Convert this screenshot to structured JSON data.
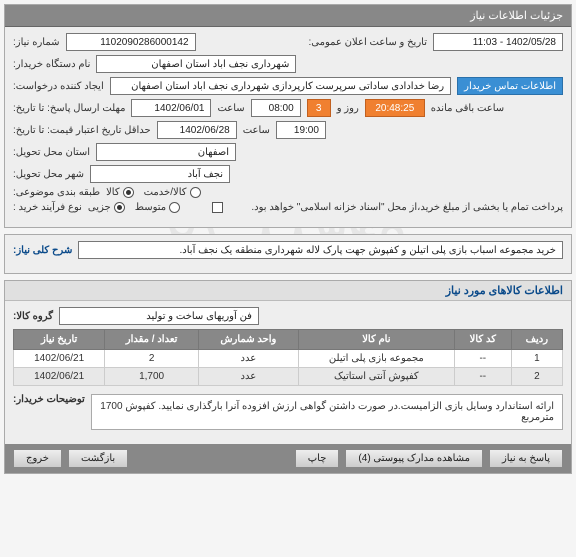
{
  "header": {
    "title": "جزئیات اطلاعات نیاز"
  },
  "info": {
    "reqNoLabel": "شماره نیاز:",
    "reqNo": "1102090286000142",
    "pubDateLabel": "تاریخ و ساعت اعلان عمومی:",
    "pubDate": "1402/05/28 - 11:03",
    "buyerLabel": "نام دستگاه خریدار:",
    "buyer": "شهرداری نجف اباد استان اصفهان",
    "creatorLabel": "ایجاد کننده درخواست:",
    "creatorValue": "رضا خدادادی ساداتی سرپرست  کارپردازی شهرداری نجف اباد استان اصفهان",
    "contactBtn": "اطلاعات تماس خریدار",
    "responseEndLabel": "مهلت ارسال پاسخ: تا تاریخ:",
    "responseEndDate": "1402/06/01",
    "hourLabel": "ساعت",
    "responseEndHour": "08:00",
    "daysSuffix": "روز و",
    "countdownDays": "3",
    "countdown": "20:48:25",
    "remainLabel": "ساعت باقی مانده",
    "priceValidLabel": "حداقل تاریخ اعتبار قیمت: تا تاریخ:",
    "priceValidDate": "1402/06/28",
    "priceValidHour": "19:00",
    "provinceLabel": "استان محل تحویل:",
    "province": "اصفهان",
    "cityLabel": "شهر محل تحویل:",
    "city": "نجف آباد",
    "classLabel": "طبقه بندی موضوعی:",
    "classKala": "کالا",
    "classKhedmat": "کالا/خدمت",
    "processLabel": "نوع فرآیند خرید :",
    "processJozi": "جزیی",
    "processMotavaset": "متوسط",
    "partialPayNote": "پرداخت تمام یا بخشی از مبلغ خرید،از محل \"اسناد خزانه اسلامی\" خواهد بود."
  },
  "summary": {
    "titleLabel": "شرح کلی نیاز:",
    "titleValue": "خرید مجموعه اسباب بازی پلی اتیلن و کفپوش جهت پارک لاله شهرداری منطقه یک نجف آباد."
  },
  "itemsSection": {
    "header": "اطلاعات کالاهای مورد نیاز",
    "groupLabel": "گروه کالا:",
    "groupValue": "فن آوریهای ساخت و تولید",
    "cols": {
      "row": "ردیف",
      "code": "کد کالا",
      "name": "نام کالا",
      "unit": "واحد شمارش",
      "qty": "تعداد / مقدار",
      "date": "تاریخ نیاز"
    },
    "rows": [
      {
        "idx": "1",
        "code": "--",
        "name": "مجموعه بازی پلی اتیلن",
        "unit": "عدد",
        "qty": "2",
        "date": "1402/06/21"
      },
      {
        "idx": "2",
        "code": "--",
        "name": "کفپوش آنتی استاتیک",
        "unit": "عدد",
        "qty": "1,700",
        "date": "1402/06/21"
      }
    ]
  },
  "buyerDesc": {
    "label": "توضیحات خریدار:",
    "value": "ارائه استاندارد وسایل بازی الزامیست.در صورت داشتن گواهی ارزش افزوده آنرا بارگذاری نمایید. کفپوش 1700 مترمربع"
  },
  "footer": {
    "respond": "پاسخ به نیاز",
    "attachments": "مشاهده مدارک پیوستی (4)",
    "print": "چاپ",
    "back": "بازگشت",
    "exit": "خروج"
  }
}
